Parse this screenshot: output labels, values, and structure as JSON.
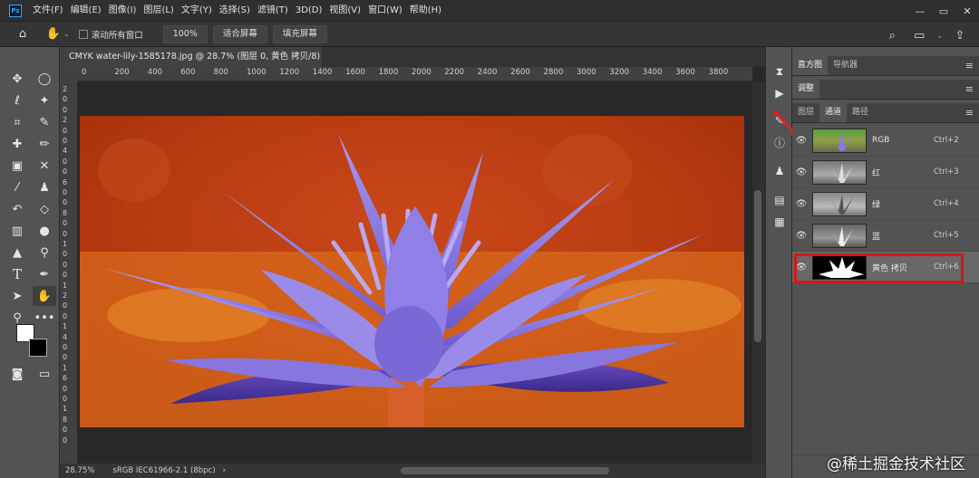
{
  "menubar": {
    "logo": "Ps",
    "items": [
      "文件(F)",
      "编辑(E)",
      "图像(I)",
      "图层(L)",
      "文字(Y)",
      "选择(S)",
      "滤镜(T)",
      "3D(D)",
      "视图(V)",
      "窗口(W)",
      "帮助(H)"
    ],
    "window_controls": [
      "—",
      "▭",
      "✕"
    ]
  },
  "options": {
    "scroll_all_label": "滚动所有窗口",
    "zoom_value": "100%",
    "fit_screen": "适合屏幕",
    "fill_screen": "填充屏幕"
  },
  "document": {
    "tab_title": "CMYK water-lily-1585178.jpg @ 28.7% (图层 0, 黄色 拷贝/8) *",
    "close": "×",
    "zoom_status": "28.75%",
    "color_profile": "sRGB IEC61966-2.1 (8bpc)",
    "status_arrow": "›"
  },
  "ruler": {
    "h_ticks": [
      "0",
      "200",
      "400",
      "600",
      "800",
      "1000",
      "1200",
      "1400",
      "1600",
      "1800",
      "2000",
      "2200",
      "2400",
      "2600",
      "2800",
      "3000",
      "3200",
      "3400",
      "3600",
      "3800"
    ],
    "v_ticks": [
      "2",
      "0",
      "0",
      "2",
      "0",
      "0",
      "4",
      "0",
      "0",
      "6",
      "0",
      "0",
      "8",
      "0",
      "0",
      "1",
      "0",
      "0",
      "0",
      "1",
      "2",
      "0",
      "0",
      "1",
      "4",
      "0",
      "0",
      "1",
      "6",
      "0",
      "0",
      "1",
      "8",
      "0",
      "0"
    ]
  },
  "panels": {
    "top_tabs": [
      "直方图",
      "导航器"
    ],
    "adjust_tab": "调整",
    "layer_tabs": [
      "图层",
      "通道",
      "路径"
    ],
    "active_layer_tab": "通道",
    "menu_icon": "≡",
    "channels": [
      {
        "name": "RGB",
        "shortcut": "Ctrl+2"
      },
      {
        "name": "红",
        "shortcut": "Ctrl+3"
      },
      {
        "name": "绿",
        "shortcut": "Ctrl+4"
      },
      {
        "name": "蓝",
        "shortcut": "Ctrl+5"
      },
      {
        "name": "黄色 拷贝",
        "shortcut": "Ctrl+6"
      }
    ]
  },
  "watermark": "@稀土掘金技术社区",
  "colors": {
    "accent_red": "#d11818",
    "ps_blue": "#31a8ff"
  },
  "icons": [
    "home-icon",
    "hand-icon",
    "move-icon",
    "marquee-icon",
    "lasso-icon",
    "magic-wand-icon",
    "crop-icon",
    "eyedropper-icon",
    "healing-icon",
    "brush-icon",
    "stamp-icon",
    "history-brush-icon",
    "eraser-icon",
    "gradient-icon",
    "blur-icon",
    "dodge-icon",
    "pen-icon",
    "type-icon",
    "path-select-icon",
    "shape-icon",
    "zoom-icon",
    "more-icon",
    "search-icon",
    "workspace-icon",
    "share-icon",
    "eye-icon",
    "arrow-icon"
  ]
}
